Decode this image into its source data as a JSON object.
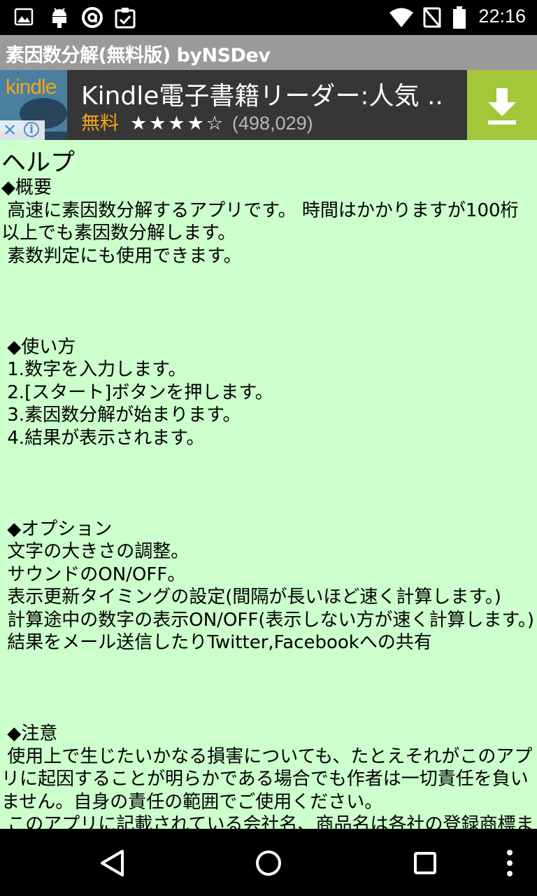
{
  "status_bar": {
    "time": "22:16",
    "left_icons": [
      "image-icon",
      "android-icon",
      "at-sign-icon",
      "clipboard-check-icon"
    ],
    "right_icons": [
      "wifi-icon",
      "no-signal-icon",
      "battery-icon"
    ]
  },
  "app": {
    "title": "素因数分解(無料版) byNSDev"
  },
  "ad": {
    "brand": "kindle",
    "title": "Kindle電子書籍リーダー:人気 ...",
    "price": "無料",
    "stars": "★★★★☆",
    "rating_count": "(498,029)",
    "colors": {
      "accent": "#f2a51b",
      "download_bg": "#a4c639"
    }
  },
  "help": {
    "heading": "ヘルプ",
    "body": "◆概要\n 高速に素因数分解するアプリです。 時間はかかりますが100桁以上でも素因数分解します。\n 素数判定にも使用できます。\n\n\n\n ◆使い方\n 1.数字を入力します。\n 2.[スタート]ボタンを押します。\n 3.素因数分解が始まります。\n 4.結果が表示されます。\n\n\n\n ◆オプション\n 文字の大きさの調整。\n サウンドのON/OFF。\n 表示更新タイミングの設定(間隔が長いほど速く計算します。)\n 計算途中の数字の表示ON/OFF(表示しない方が速く計算します。)\n 結果をメール送信したりTwitter,Facebookへの共有\n\n\n\n ◆注意\n 使用上で生じたいかなる損害についても、たとえそれがこのアプリに起因することが明らかである場合でも作者は一切責任を負いません。自身の責任の範囲でご使用ください。\n このアプリに記載されている会社名、商品名は各社の登録商標または商標です。",
    "background": "#ccffcc"
  },
  "nav_bar": {
    "buttons": [
      "back-icon",
      "home-icon",
      "recents-icon",
      "overflow-menu-icon"
    ]
  }
}
